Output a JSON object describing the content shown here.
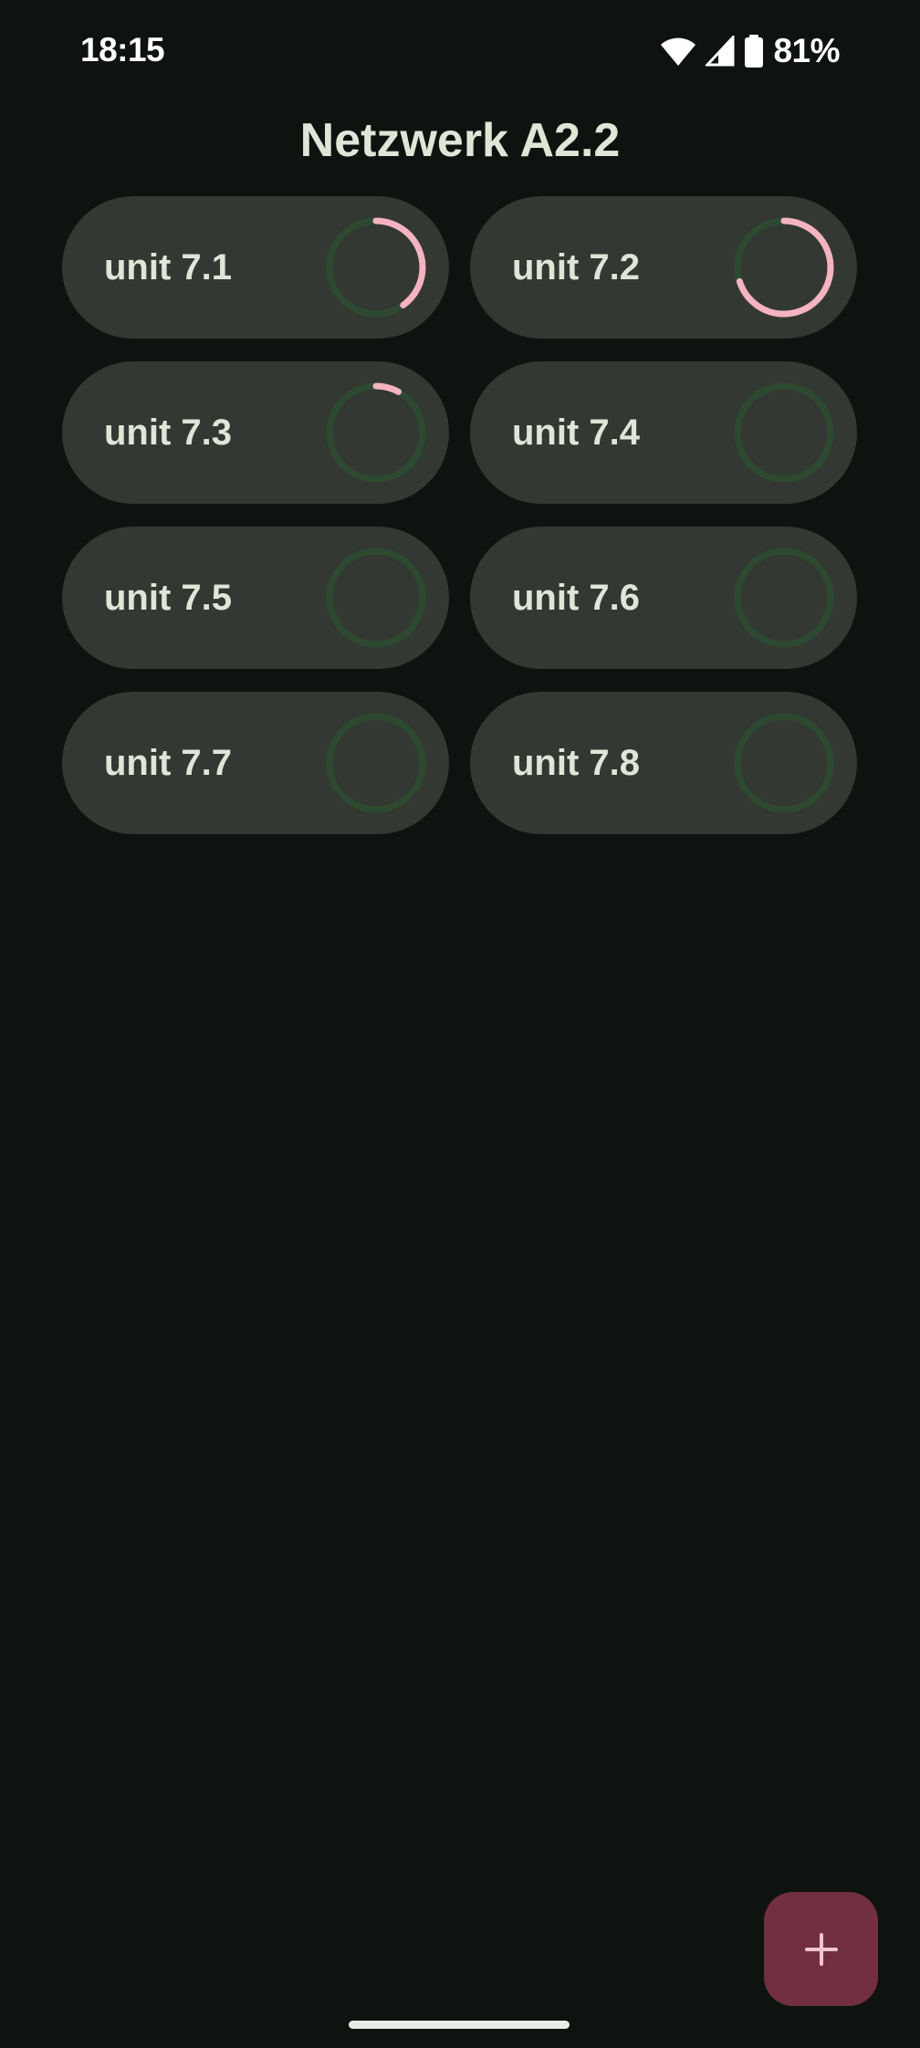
{
  "status_bar": {
    "time": "18:15",
    "battery": "81%"
  },
  "title": "Netzwerk A2.2",
  "colors": {
    "background": "#0f1310",
    "card": "#343833",
    "progress": "#f5b3c0",
    "track": "#2d4a31",
    "fab": "#722f41"
  },
  "units": [
    {
      "label": "unit 7.1",
      "progress": 0.4
    },
    {
      "label": "unit 7.2",
      "progress": 0.7
    },
    {
      "label": "unit 7.3",
      "progress": 0.08
    },
    {
      "label": "unit 7.4",
      "progress": 0
    },
    {
      "label": "unit 7.5",
      "progress": 0
    },
    {
      "label": "unit 7.6",
      "progress": 0
    },
    {
      "label": "unit 7.7",
      "progress": 0
    },
    {
      "label": "unit 7.8",
      "progress": 0
    }
  ],
  "fab": {
    "icon": "plus-icon"
  }
}
